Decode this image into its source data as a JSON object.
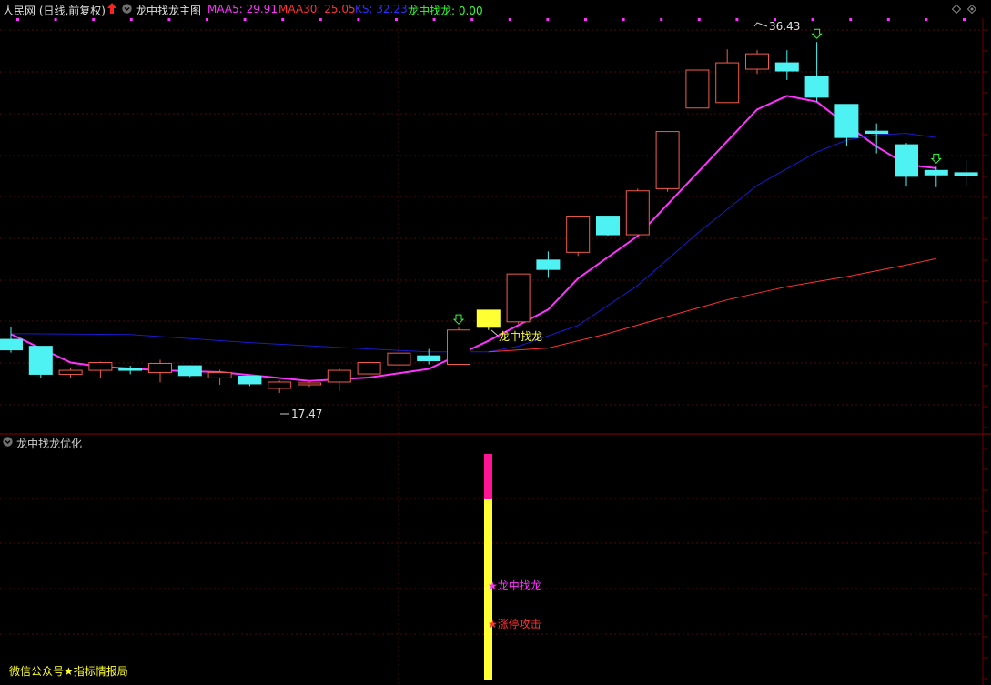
{
  "header": {
    "stock": "人民网 (日线,前复权)",
    "indicator": "龙中找龙主图",
    "maa5_label": "MAA5: 29.91",
    "maa30_label": "MAA30: 25.05",
    "ks_label": "KS: 32.23",
    "signal_label": "龙中找龙: 0.00"
  },
  "sub_panel": {
    "title": "龙中找龙优化",
    "label_dragon": "★龙中找龙",
    "label_limitup": "★涨停攻击",
    "watermark": "微信公众号★指标情报局"
  },
  "colors": {
    "up": "#f25c4a",
    "down": "#4ff2f2",
    "maa5": "#ff33ff",
    "maa30": "#ff3333",
    "ks": "#1a1acc",
    "signal": "#33ff33",
    "highlight": "#ffff33",
    "magenta_bar": "#ff1493"
  },
  "chart_data": {
    "type": "candlestick",
    "ylim": [
      15.2,
      38.2
    ],
    "annotations": {
      "high_label": "36.43",
      "low_label": "17.47",
      "signal_text": "龙中找龙"
    },
    "candles": [
      {
        "o": 20.43,
        "h": 21.1,
        "l": 19.7,
        "c": 19.85,
        "dir": "down"
      },
      {
        "o": 20.05,
        "h": 20.0,
        "l": 18.3,
        "c": 18.5,
        "dir": "down"
      },
      {
        "o": 18.5,
        "h": 18.85,
        "l": 18.3,
        "c": 18.72,
        "dir": "up"
      },
      {
        "o": 18.72,
        "h": 19.2,
        "l": 18.3,
        "c": 19.15,
        "dir": "up"
      },
      {
        "o": 18.82,
        "h": 18.97,
        "l": 18.5,
        "c": 18.72,
        "dir": "down"
      },
      {
        "o": 18.6,
        "h": 19.3,
        "l": 18.05,
        "c": 19.1,
        "dir": "up"
      },
      {
        "o": 18.97,
        "h": 19.0,
        "l": 18.35,
        "c": 18.43,
        "dir": "down"
      },
      {
        "o": 18.6,
        "h": 18.75,
        "l": 17.92,
        "c": 18.3,
        "dir": "up"
      },
      {
        "o": 18.4,
        "h": 18.4,
        "l": 17.85,
        "c": 17.97,
        "dir": "down"
      },
      {
        "o": 17.72,
        "h": 18.15,
        "l": 17.47,
        "c": 18.07,
        "dir": "up"
      },
      {
        "o": 17.97,
        "h": 18.07,
        "l": 17.82,
        "c": 18.02,
        "dir": "up"
      },
      {
        "o": 18.07,
        "h": 18.82,
        "l": 17.57,
        "c": 18.72,
        "dir": "up"
      },
      {
        "o": 18.52,
        "h": 19.3,
        "l": 18.42,
        "c": 19.15,
        "dir": "up"
      },
      {
        "o": 19.02,
        "h": 19.95,
        "l": 18.92,
        "c": 19.67,
        "dir": "up"
      },
      {
        "o": 19.52,
        "h": 19.9,
        "l": 19.05,
        "c": 19.25,
        "dir": "down"
      },
      {
        "o": 19.05,
        "h": 21.08,
        "l": 19.05,
        "c": 20.95,
        "dir": "up"
      },
      {
        "o": 21.1,
        "h": 22.0,
        "l": 20.95,
        "c": 22.05,
        "dir": "highlight"
      },
      {
        "o": 21.4,
        "h": 24.05,
        "l": 21.3,
        "c": 24.05,
        "dir": "up"
      },
      {
        "o": 24.82,
        "h": 25.3,
        "l": 23.83,
        "c": 24.3,
        "dir": "down"
      },
      {
        "o": 25.25,
        "h": 27.25,
        "l": 25.05,
        "c": 27.25,
        "dir": "up"
      },
      {
        "o": 27.25,
        "h": 27.25,
        "l": 26.17,
        "c": 26.22,
        "dir": "down"
      },
      {
        "o": 26.22,
        "h": 28.77,
        "l": 26.22,
        "c": 28.65,
        "dir": "up"
      },
      {
        "o": 28.77,
        "h": 31.93,
        "l": 28.6,
        "c": 31.93,
        "dir": "up"
      },
      {
        "o": 33.23,
        "h": 34.4,
        "l": 33.23,
        "c": 35.33,
        "dir": "up"
      },
      {
        "o": 33.53,
        "h": 36.48,
        "l": 33.53,
        "c": 35.73,
        "dir": "up"
      },
      {
        "o": 35.38,
        "h": 36.43,
        "l": 35.12,
        "c": 36.23,
        "dir": "up"
      },
      {
        "o": 35.73,
        "h": 36.43,
        "l": 34.78,
        "c": 35.28,
        "dir": "down"
      },
      {
        "o": 34.98,
        "h": 36.88,
        "l": 33.58,
        "c": 33.83,
        "dir": "down"
      },
      {
        "o": 33.43,
        "h": 33.43,
        "l": 31.15,
        "c": 31.6,
        "dir": "down"
      },
      {
        "o": 31.95,
        "h": 32.38,
        "l": 30.72,
        "c": 31.83,
        "dir": "down"
      },
      {
        "o": 31.2,
        "h": 31.3,
        "l": 28.88,
        "c": 29.45,
        "dir": "down"
      },
      {
        "o": 29.78,
        "h": 29.98,
        "l": 28.85,
        "c": 29.53,
        "dir": "down"
      },
      {
        "o": 29.65,
        "h": 30.35,
        "l": 28.9,
        "c": 29.5,
        "dir": "down"
      }
    ],
    "series": [
      {
        "key": "MAA5",
        "color": "#ff33ff",
        "width": 2,
        "values": [
          [
            0,
            20.72
          ],
          [
            2,
            19.15
          ],
          [
            3,
            18.92
          ],
          [
            5,
            18.72
          ],
          [
            7,
            18.62
          ],
          [
            10,
            18.13
          ],
          [
            12,
            18.32
          ],
          [
            14,
            18.8
          ],
          [
            16,
            20.35
          ],
          [
            18,
            22.08
          ],
          [
            19,
            23.8
          ],
          [
            21,
            26.15
          ],
          [
            23,
            29.65
          ],
          [
            25,
            33.15
          ],
          [
            26,
            33.9
          ],
          [
            27,
            33.58
          ],
          [
            28,
            32.3
          ],
          [
            29,
            31.1
          ],
          [
            30,
            30.1
          ],
          [
            31,
            29.9
          ]
        ]
      },
      {
        "key": "KS",
        "color": "#1a1acc",
        "width": 1,
        "values": [
          [
            0,
            20.75
          ],
          [
            4,
            20.7
          ],
          [
            8,
            20.25
          ],
          [
            12,
            19.9
          ],
          [
            14,
            19.74
          ],
          [
            16,
            19.74
          ],
          [
            17,
            20.05
          ],
          [
            19,
            21.2
          ],
          [
            21,
            23.42
          ],
          [
            23,
            26.3
          ],
          [
            25,
            28.95
          ],
          [
            27,
            30.8
          ],
          [
            28,
            31.45
          ],
          [
            29,
            31.75
          ],
          [
            30,
            31.83
          ],
          [
            31,
            31.6
          ]
        ]
      },
      {
        "key": "MAA30",
        "color": "#ff3333",
        "width": 1,
        "values": [
          [
            16,
            19.74
          ],
          [
            18,
            19.95
          ],
          [
            20,
            20.75
          ],
          [
            22,
            21.7
          ],
          [
            24,
            22.62
          ],
          [
            26,
            23.35
          ],
          [
            28,
            23.9
          ],
          [
            30,
            24.55
          ],
          [
            31,
            24.9
          ]
        ]
      }
    ],
    "signal_arrows": [
      15,
      27,
      31
    ]
  }
}
